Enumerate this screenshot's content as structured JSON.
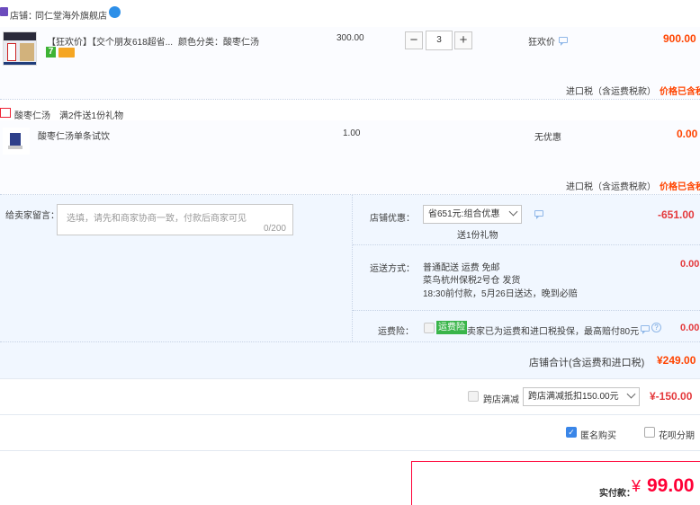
{
  "shop": {
    "label": "店铺：",
    "name": "同仁堂海外旗舰店"
  },
  "item1": {
    "title": "【狂欢价】【交个朋友618超省...",
    "spec": "颜色分类：酸枣仁汤",
    "price": "300.00",
    "qty": "3",
    "promo": "狂欢价",
    "total": "900.00",
    "tax_label": "进口税（含运费税款）",
    "tax_value": "价格已含税",
    "badge7": "7"
  },
  "gift": {
    "label": "酸枣仁汤",
    "desc": "满2件送1份礼物",
    "item_title": "酸枣仁汤单条试饮",
    "price": "1.00",
    "promo": "无优惠",
    "total": "0.00",
    "tax_label": "进口税（含运费税款）",
    "tax_value": "价格已含税"
  },
  "message": {
    "label": "给卖家留言：",
    "placeholder": "选填，请先和商家协商一致，付款后商家可见",
    "counter": "0/200"
  },
  "discount": {
    "label": "店铺优惠：",
    "selected": "省651元:组合优惠",
    "gift_note": "送1份礼物",
    "value": "-651.00"
  },
  "shipping": {
    "label": "运送方式：",
    "line1": "普通配送 运费 免邮",
    "line2": "菜鸟杭州保税2号仓   发货",
    "line3": "18:30前付款，5月26日送达，晚到必赔",
    "value": "0.00"
  },
  "insurance": {
    "label": "运费险：",
    "tag": "运费险",
    "desc": "卖家已为运费和进口税投保，最高赔付80元",
    "value": "0.00"
  },
  "store_total": {
    "label": "店铺合计(含运费和进口税)",
    "value": "¥249.00"
  },
  "cross_store": {
    "label": "跨店满减",
    "selected": "跨店满减抵扣150.00元",
    "value": "¥-150.00"
  },
  "options": {
    "anonymous": "匿名购买",
    "huabei": "花呗分期"
  },
  "payment": {
    "label": "实付款：",
    "currency": "¥",
    "amount": "99.00"
  },
  "colors": {
    "price": "#ff4400",
    "discount": "#e4393c",
    "accent": "#ff0036",
    "bluebg": "#f1f7ff"
  }
}
